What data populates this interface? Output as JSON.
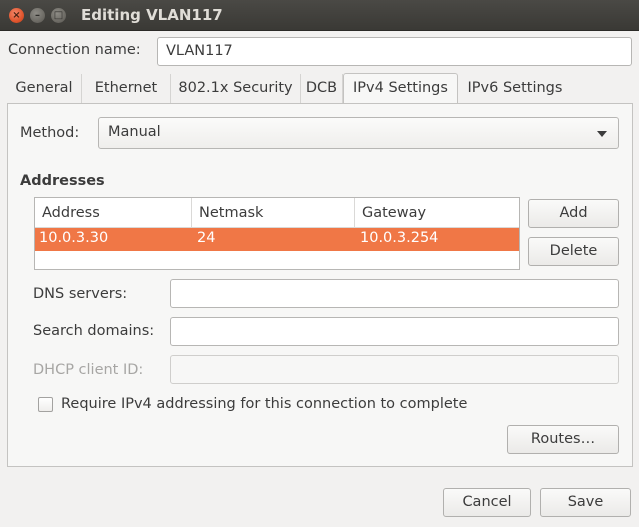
{
  "window": {
    "title": "Editing VLAN117",
    "close_icon": "×",
    "minimize_icon": "–",
    "maximize_icon": "□"
  },
  "connection": {
    "name_label": "Connection name:",
    "name_value": "VLAN117"
  },
  "tabs": [
    {
      "label": "General"
    },
    {
      "label": "Ethernet"
    },
    {
      "label": "802.1x Security"
    },
    {
      "label": "DCB"
    },
    {
      "label": "IPv4 Settings"
    },
    {
      "label": "IPv6 Settings"
    }
  ],
  "active_tab": "IPv4 Settings",
  "ipv4": {
    "method_label": "Method:",
    "method_value": "Manual",
    "addresses_heading": "Addresses",
    "columns": [
      "Address",
      "Netmask",
      "Gateway"
    ],
    "rows": [
      {
        "address": "10.0.3.30",
        "netmask": "24",
        "gateway": "10.0.3.254"
      }
    ],
    "add_label": "Add",
    "delete_label": "Delete",
    "dns_label": "DNS servers:",
    "dns_value": "",
    "search_label": "Search domains:",
    "search_value": "",
    "dhcp_label": "DHCP client ID:",
    "dhcp_value": "",
    "require_label": "Require IPv4 addressing for this connection to complete",
    "require_checked": false,
    "routes_label": "Routes…"
  },
  "footer": {
    "cancel_label": "Cancel",
    "save_label": "Save"
  },
  "colors": {
    "selection": "#f07746",
    "titlebar": "#3c3b37",
    "close_button": "#e0552d"
  }
}
